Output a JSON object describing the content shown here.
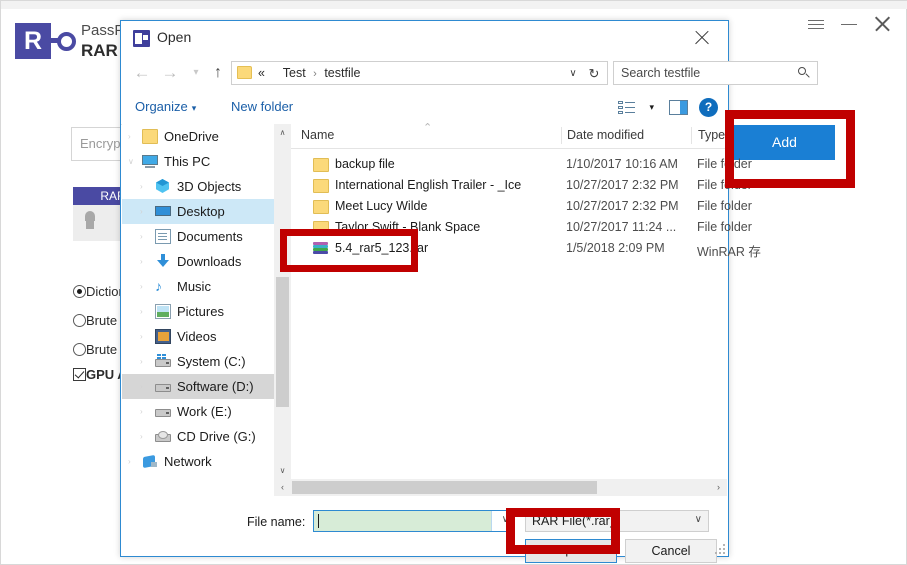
{
  "app": {
    "brand_line1": "PassFab for",
    "brand_line2": "RAR",
    "logo_letter": "R",
    "window_controls": {
      "menu": "menu-icon",
      "minimize": "minimize-icon",
      "close": "close-icon"
    },
    "encrypt_box_label": "Encrypted",
    "rar_tab_label": "RAR",
    "options": [
      {
        "label": "Dictionary Attack",
        "type": "radio",
        "checked": true
      },
      {
        "label": "Brute Force with Mask Attack",
        "type": "radio",
        "checked": false
      },
      {
        "label": "Brute Force Attack",
        "type": "radio",
        "checked": false
      },
      {
        "label": "GPU Acceleration",
        "type": "checkbox",
        "checked": true
      }
    ],
    "add_button_label": "Add",
    "add_button_color": "#1a7fd4"
  },
  "dialog": {
    "title": "Open",
    "close_label": "✕",
    "nav": {
      "back": "←",
      "forward": "→",
      "recent": "▾",
      "up": "↑"
    },
    "breadcrumb": {
      "prefix": "«",
      "parts": [
        "Test",
        "testfile"
      ],
      "separator": "›",
      "chevron": "∨",
      "refresh": "↻"
    },
    "search": {
      "placeholder": "Search testfile",
      "value": "Search testfile"
    },
    "toolbar": {
      "organize_label": "Organize",
      "organize_caret": "▾",
      "new_folder_label": "New folder",
      "view_caret": "▾",
      "help_label": "?"
    },
    "nav_pane": {
      "items": [
        {
          "label": "OneDrive",
          "icon": "folder-icon",
          "level": 1,
          "chevron": "›",
          "state": "none"
        },
        {
          "label": "This PC",
          "icon": "this-pc-icon",
          "level": 1,
          "chevron": "∨",
          "state": "none"
        },
        {
          "label": "3D Objects",
          "icon": "3d-objects-icon",
          "level": 2,
          "chevron": "›",
          "state": "none"
        },
        {
          "label": "Desktop",
          "icon": "desktop-icon",
          "level": 2,
          "chevron": "›",
          "state": "selected-blue"
        },
        {
          "label": "Documents",
          "icon": "documents-icon",
          "level": 2,
          "chevron": "›",
          "state": "none"
        },
        {
          "label": "Downloads",
          "icon": "downloads-icon",
          "level": 2,
          "chevron": "›",
          "state": "none"
        },
        {
          "label": "Music",
          "icon": "music-icon",
          "level": 2,
          "chevron": "›",
          "state": "none"
        },
        {
          "label": "Pictures",
          "icon": "pictures-icon",
          "level": 2,
          "chevron": "›",
          "state": "none"
        },
        {
          "label": "Videos",
          "icon": "videos-icon",
          "level": 2,
          "chevron": "›",
          "state": "none"
        },
        {
          "label": "System (C:)",
          "icon": "system-drive-icon",
          "level": 2,
          "chevron": "›",
          "state": "none"
        },
        {
          "label": "Software (D:)",
          "icon": "drive-icon",
          "level": 2,
          "chevron": "›",
          "state": "selected-gray"
        },
        {
          "label": "Work (E:)",
          "icon": "drive-icon",
          "level": 2,
          "chevron": "›",
          "state": "none"
        },
        {
          "label": "CD Drive (G:)",
          "icon": "cd-drive-icon",
          "level": 2,
          "chevron": "›",
          "state": "none"
        },
        {
          "label": "Network",
          "icon": "network-icon",
          "level": 1,
          "chevron": "›",
          "state": "none"
        }
      ],
      "scroll_up": "∧",
      "scroll_down": "∨"
    },
    "file_list": {
      "columns": [
        "Name",
        "Date modified",
        "Type"
      ],
      "sort_indicator": "⌃",
      "rows": [
        {
          "name": "backup file",
          "date": "1/10/2017 10:16 AM",
          "type": "File folder",
          "icon": "folder-icon"
        },
        {
          "name": "International English Trailer - _Ice",
          "date": "10/27/2017 2:32 PM",
          "type": "File folder",
          "icon": "folder-icon"
        },
        {
          "name": "Meet Lucy Wilde",
          "date": "10/27/2017 2:32 PM",
          "type": "File folder",
          "icon": "folder-icon"
        },
        {
          "name": "Taylor Swift - Blank Space",
          "date": "10/27/2017 11:24 ...",
          "type": "File folder",
          "icon": "folder-icon"
        },
        {
          "name": "5.4_rar5_123.rar",
          "date": "1/5/2018 2:09 PM",
          "type": "WinRAR 存",
          "icon": "rar-archive-icon"
        }
      ],
      "hscroll_left": "‹",
      "hscroll_right": "›"
    },
    "footer": {
      "file_name_label": "File name:",
      "file_name_value": "",
      "file_name_caret_visible": true,
      "filter_value": "RAR File(*.rar)",
      "filter_caret": "∨",
      "open_label": "Open",
      "cancel_label": "Cancel"
    }
  },
  "annotations": {
    "color": "#c00000",
    "boxes": [
      "add-button",
      "rar-file-row",
      "open-button"
    ]
  }
}
